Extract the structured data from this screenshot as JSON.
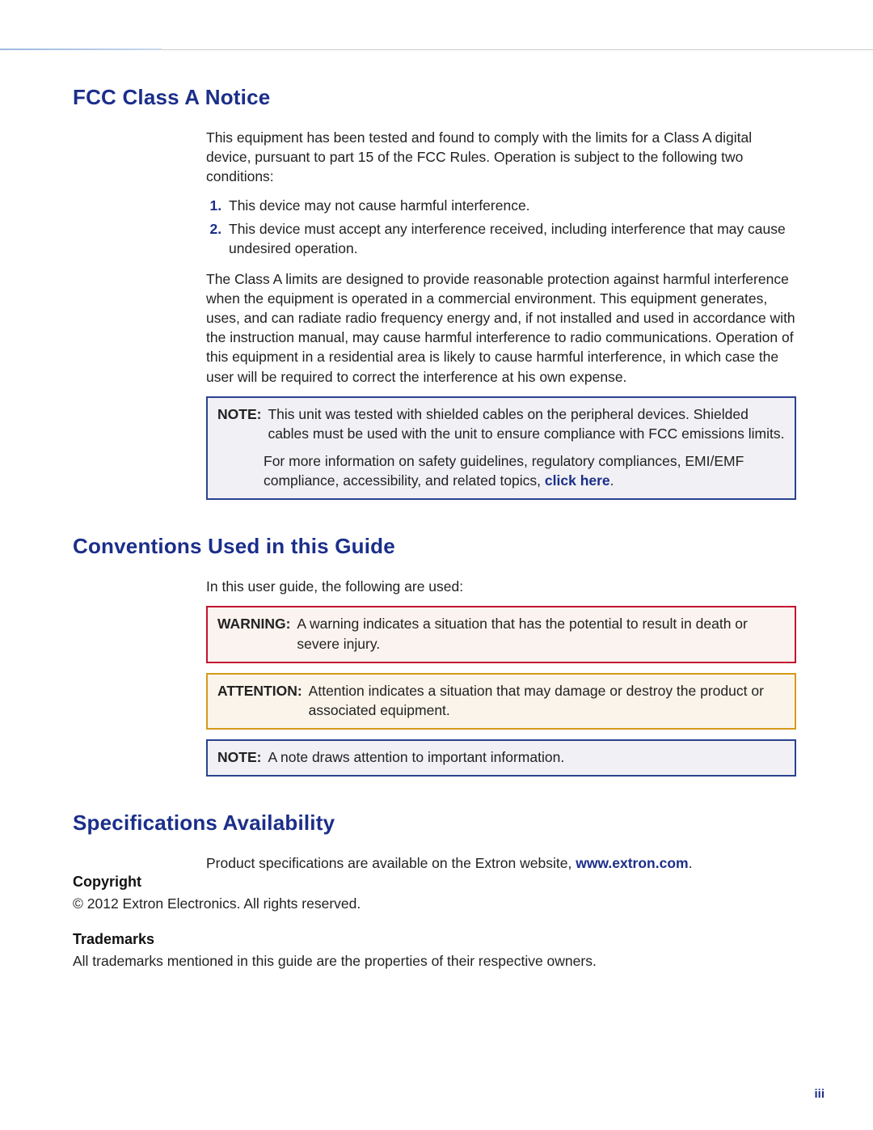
{
  "fcc": {
    "heading": "FCC Class A Notice",
    "intro": "This equipment has been tested and found to comply with the limits for a Class A digital device, pursuant to part 15 of the FCC Rules. Operation is subject to the following two conditions:",
    "list": {
      "item1": "This device may not cause harmful interference.",
      "item2": "This device must accept any interference received, including interference that may cause undesired operation."
    },
    "para2": "The Class A limits are designed to provide reasonable protection against harmful interference when the equipment is operated in a commercial environment. This equipment generates, uses, and can radiate radio frequency energy and, if not installed and used in accordance with the instruction manual, may cause harmful interference to radio communications. Operation of this equipment in a residential area is likely to cause harmful interference, in which case the user will be required to correct the interference at his own expense.",
    "note": {
      "label": "NOTE:",
      "body1": "This unit was tested with shielded cables on the peripheral devices. Shielded cables must be used with the unit to ensure compliance with FCC emissions limits.",
      "body2_pre": "For more information on safety guidelines, regulatory compliances, EMI/EMF compliance, accessibility, and related topics, ",
      "link": "click here",
      "body2_post": "."
    }
  },
  "conventions": {
    "heading": "Conventions Used in this Guide",
    "intro": "In this user guide, the following are used:",
    "warning": {
      "label": "WARNING:",
      "body": "A warning indicates a situation that has the potential to result in death or severe injury."
    },
    "attention": {
      "label": "ATTENTION:",
      "body": "Attention indicates a situation that may damage or destroy the product or associated equipment."
    },
    "note": {
      "label": "NOTE:",
      "body": "A note draws attention to important information."
    }
  },
  "specs": {
    "heading": "Specifications Availability",
    "body_pre": "Product specifications are available on the Extron website, ",
    "link": "www.extron.com",
    "body_post": "."
  },
  "footer": {
    "copyright_heading": "Copyright",
    "copyright_body": "© 2012  Extron Electronics. All rights reserved.",
    "trademarks_heading": "Trademarks",
    "trademarks_body": "All trademarks mentioned in this guide are the properties of their respective owners."
  },
  "page_number": "iii"
}
